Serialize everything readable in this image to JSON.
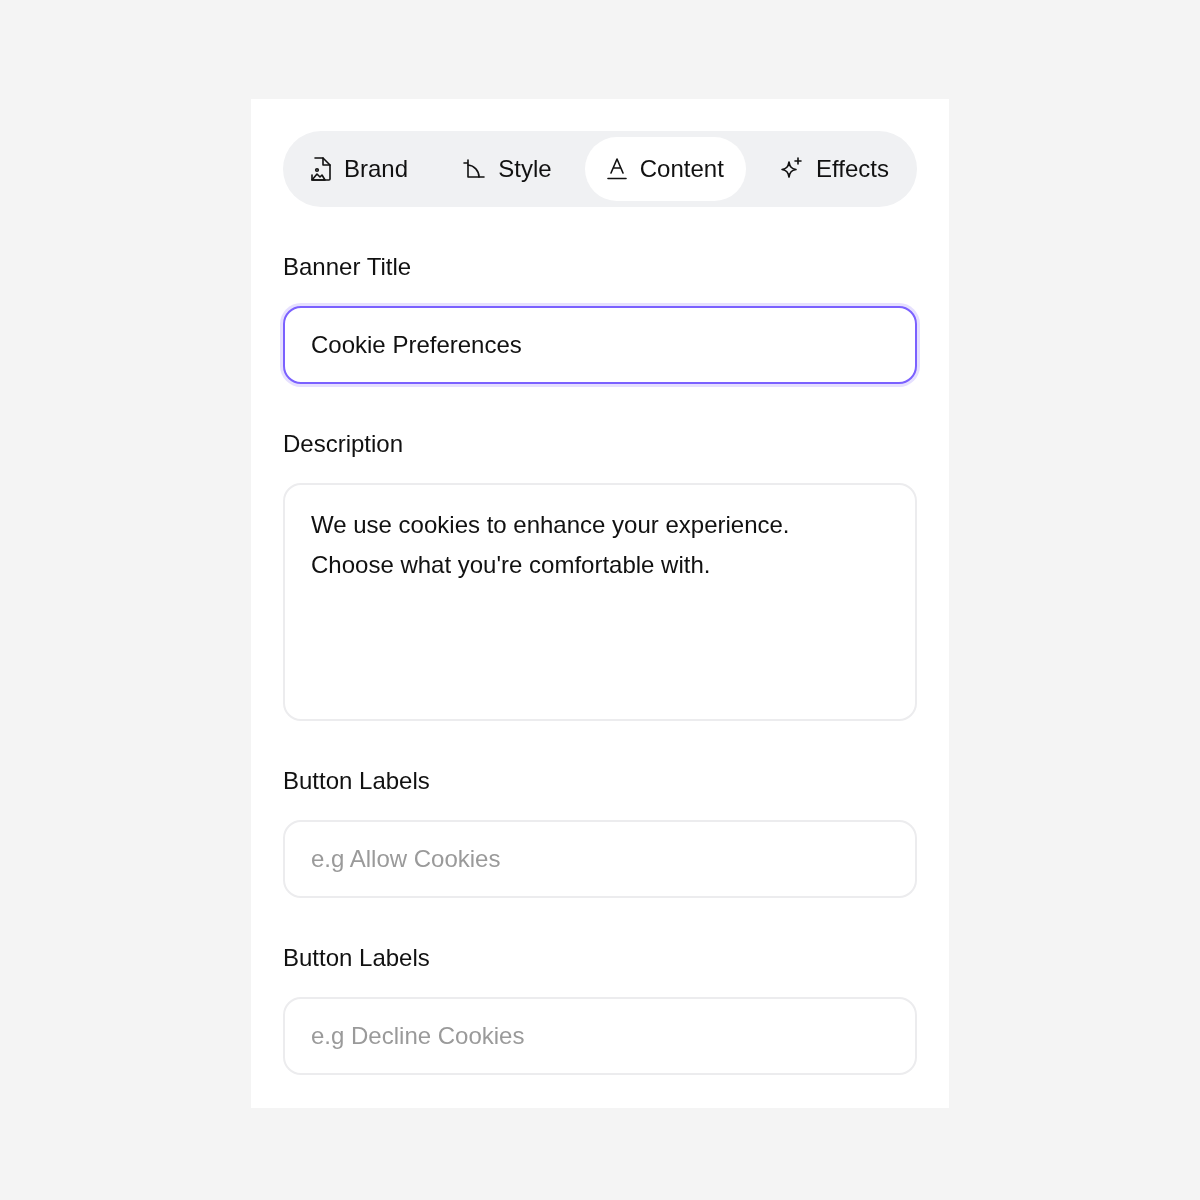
{
  "tabs": [
    {
      "label": "Brand",
      "selected": false
    },
    {
      "label": "Style",
      "selected": false
    },
    {
      "label": "Content",
      "selected": true
    },
    {
      "label": "Effects",
      "selected": false
    }
  ],
  "fields": [
    {
      "label": "Banner Title",
      "kind": "input",
      "value": "Cookie Preferences",
      "focused": true
    },
    {
      "label": "Description",
      "kind": "textarea",
      "value": "We use cookies to enhance your experience. Choose what you're comfortable with.",
      "focused": false
    },
    {
      "label": "Button Labels",
      "kind": "input",
      "placeholder": "e.g Allow Cookies",
      "focused": false
    },
    {
      "label": "Button Labels",
      "kind": "input",
      "placeholder": "e.g Decline Cookies",
      "focused": false
    }
  ]
}
